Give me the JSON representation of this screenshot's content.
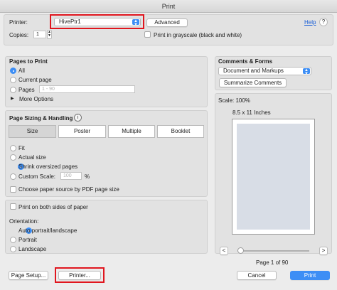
{
  "window": {
    "title": "Print"
  },
  "printer": {
    "label": "Printer:",
    "selected": "HivePtr1",
    "advanced_label": "Advanced",
    "help_label": "Help"
  },
  "copies": {
    "label": "Copies:",
    "value": "1",
    "grayscale_label": "Print in grayscale (black and white)"
  },
  "pages_to_print": {
    "heading": "Pages to Print",
    "options": [
      "All",
      "Current page",
      "Pages"
    ],
    "selected": "All",
    "pages_placeholder": "1 - 90",
    "more_options_label": "More Options"
  },
  "sizing": {
    "heading": "Page Sizing & Handling",
    "info_icon": "i",
    "tabs": [
      "Size",
      "Poster",
      "Multiple",
      "Booklet"
    ],
    "selected_tab": "Size",
    "options": [
      "Fit",
      "Actual size",
      "Shrink oversized pages",
      "Custom Scale:"
    ],
    "selected": "Shrink oversized pages",
    "scale_placeholder": "100",
    "scale_unit": "%",
    "paper_source_label": "Choose paper source by PDF page size"
  },
  "duplex": {
    "both_sides_label": "Print on both sides of paper",
    "orientation_label": "Orientation:",
    "options": [
      "Auto portrait/landscape",
      "Portrait",
      "Landscape"
    ],
    "selected": "Auto portrait/landscape"
  },
  "comments": {
    "heading": "Comments & Forms",
    "selected": "Document and Markups",
    "summarize_label": "Summarize Comments"
  },
  "preview": {
    "scale": "Scale: 100%",
    "paper": "8.5 x 11 Inches",
    "prev_label": "<",
    "next_label": ">",
    "page_info": "Page 1 of 90"
  },
  "footer": {
    "page_setup_label": "Page Setup...",
    "printer_label": "Printer...",
    "cancel_label": "Cancel",
    "print_label": "Print"
  },
  "colors": {
    "accent": "#3d8ef5",
    "highlight": "#e0161e"
  }
}
